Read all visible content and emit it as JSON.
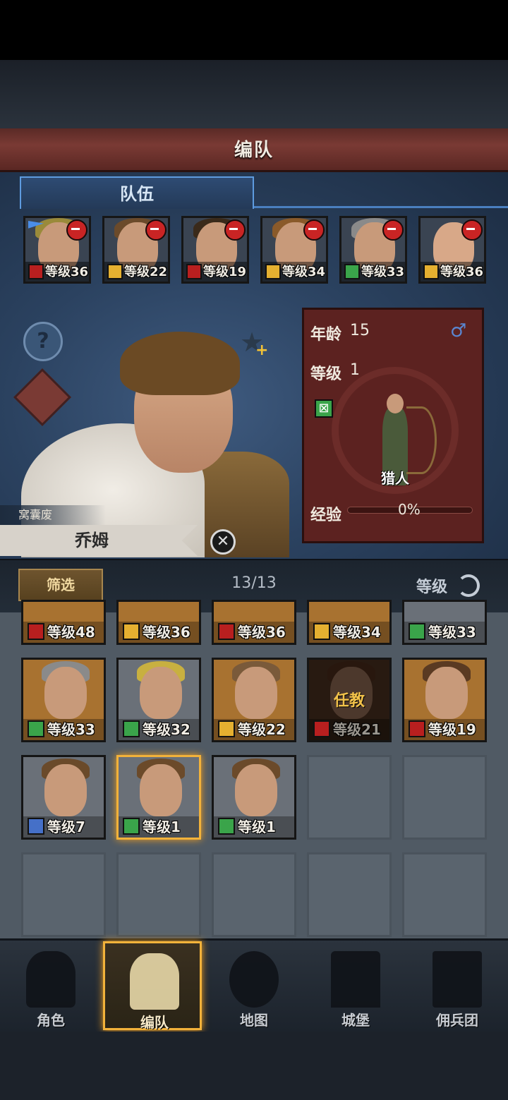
{
  "header": {
    "title": "编队"
  },
  "tabs": {
    "team": "队伍"
  },
  "team": [
    {
      "level": "等级36",
      "class_color": "#b81f1f",
      "flag": true
    },
    {
      "level": "等级22",
      "class_color": "#e5b030"
    },
    {
      "level": "等级19",
      "class_color": "#b81f1f"
    },
    {
      "level": "等级34",
      "class_color": "#e5b030"
    },
    {
      "level": "等级33",
      "class_color": "#3aa44a"
    },
    {
      "level": "等级36",
      "class_color": "#e5b030"
    }
  ],
  "hero": {
    "trait": "窝囊废",
    "name": "乔姆",
    "age_label": "年龄",
    "age": "15",
    "gender": "♂",
    "level_label": "等级",
    "level": "1",
    "class_name": "猎人",
    "exp_label": "经验",
    "exp": "0%"
  },
  "filter": {
    "label": "筛选",
    "count": "13/13",
    "sort_label": "等级"
  },
  "roster": [
    {
      "level": "等级48",
      "class_color": "#b81f1f"
    },
    {
      "level": "等级36",
      "class_color": "#e5b030"
    },
    {
      "level": "等级36",
      "class_color": "#b81f1f"
    },
    {
      "level": "等级34",
      "class_color": "#e5b030"
    },
    {
      "level": "等级33",
      "class_color": "#3aa44a"
    },
    {
      "level": "等级33",
      "class_color": "#3aa44a"
    },
    {
      "level": "等级32",
      "class_color": "#3aa44a"
    },
    {
      "level": "等级22",
      "class_color": "#e5b030"
    },
    {
      "level": "等级21",
      "class_color": "#b81f1f",
      "mission": "任教"
    },
    {
      "level": "等级19",
      "class_color": "#b81f1f"
    },
    {
      "level": "等级7",
      "class_color": "#4570c8"
    },
    {
      "level": "等级1",
      "class_color": "#3aa44a",
      "selected": true
    },
    {
      "level": "等级1",
      "class_color": "#3aa44a"
    }
  ],
  "nav": [
    {
      "label": "角色",
      "icon": "knight-icon"
    },
    {
      "label": "编队",
      "icon": "helmet-icon",
      "active": true
    },
    {
      "label": "地图",
      "icon": "compass-icon"
    },
    {
      "label": "城堡",
      "icon": "castle-icon"
    },
    {
      "label": "佣兵团",
      "icon": "banner-icon"
    }
  ]
}
